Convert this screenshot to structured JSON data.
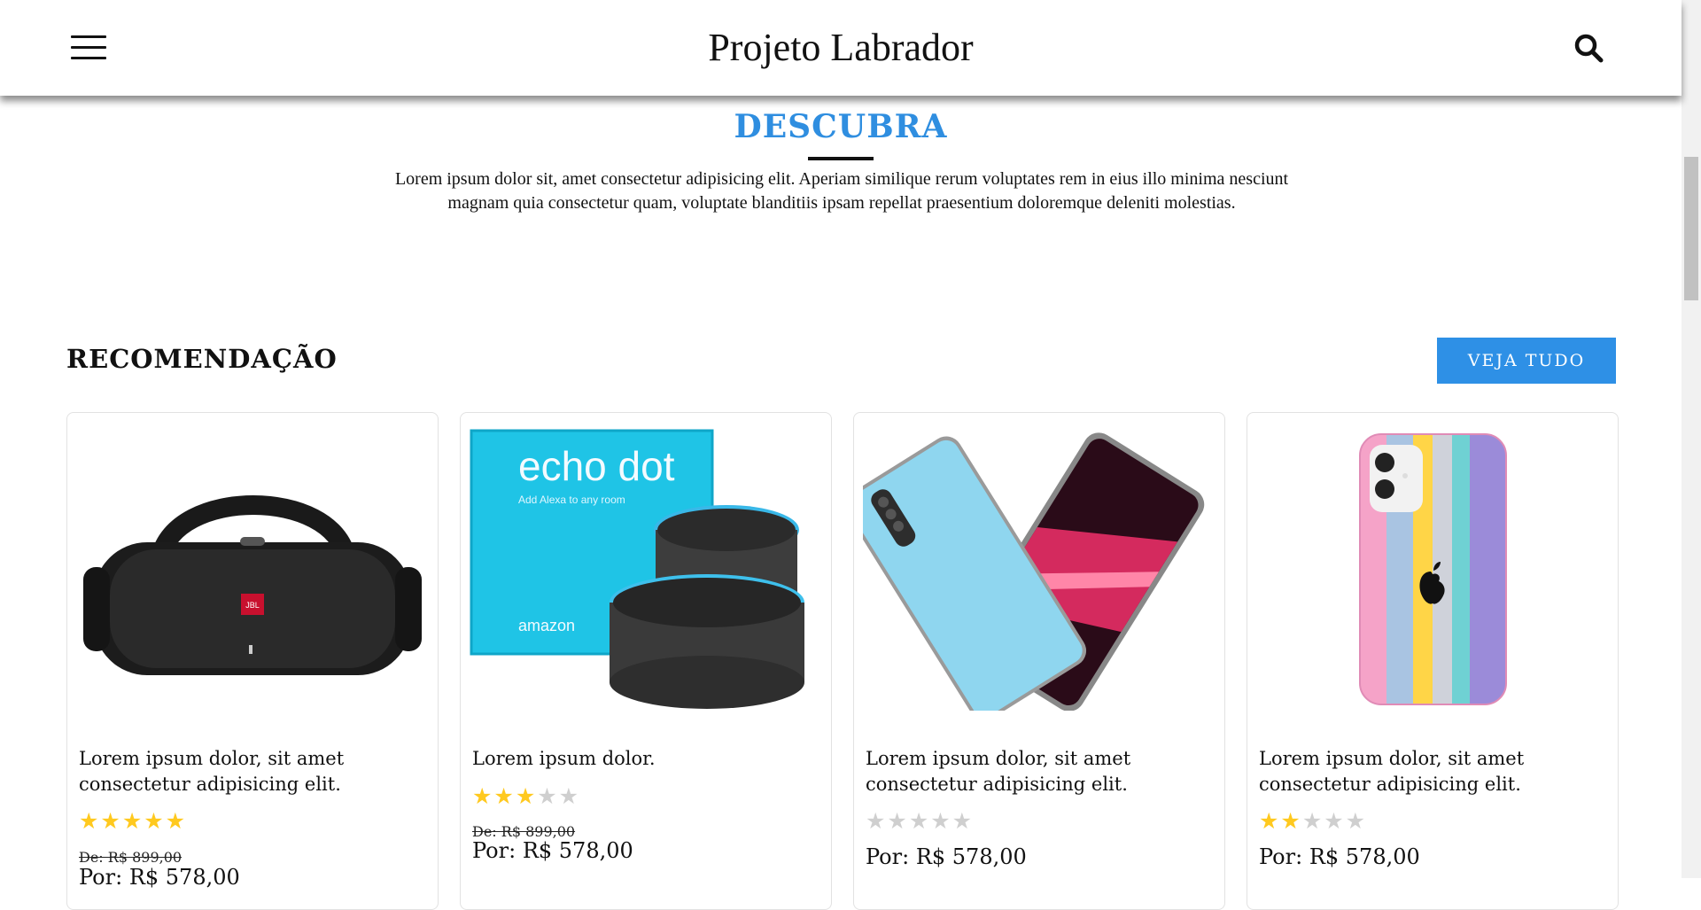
{
  "header": {
    "brand": "Projeto Labrador",
    "menu_icon": "hamburger-menu-icon",
    "search_icon": "search-icon"
  },
  "discover": {
    "title": "DESCUBRA",
    "text": "Lorem ipsum dolor sit, amet consectetur adipisicing elit. Aperiam similique rerum voluptates rem in eius illo minima nesciunt magnam quia consectetur quam, voluptate blanditiis ipsam repellat praesentium doloremque deleniti molestias."
  },
  "recommendation": {
    "title": "RECOMENDAÇÃO",
    "see_all": "VEJA TUDO",
    "products": [
      {
        "name": "Lorem ipsum dolor, sit amet consectetur adipisicing elit.",
        "image": "jbl-speaker",
        "rating": 5,
        "old_price": "De: R$ 899,00",
        "price": "Por: R$ 578,00"
      },
      {
        "name": "Lorem ipsum dolor.",
        "image": "echo-dot",
        "rating": 3,
        "old_price": "De: R$ 899,00",
        "price": "Por: R$ 578,00"
      },
      {
        "name": "Lorem ipsum dolor, sit amet consectetur adipisicing elit.",
        "image": "smartphone",
        "rating": 0,
        "old_price": "",
        "price": "Por: R$ 578,00"
      },
      {
        "name": "Lorem ipsum dolor, sit amet consectetur adipisicing elit.",
        "image": "phone-case",
        "rating": 2,
        "old_price": "",
        "price": "Por: R$ 578,00"
      }
    ]
  },
  "colors": {
    "accent": "#2e90e6",
    "title_blue": "#2f8ee0",
    "star": "#ffc91f",
    "star_empty": "#cfcfcf"
  }
}
